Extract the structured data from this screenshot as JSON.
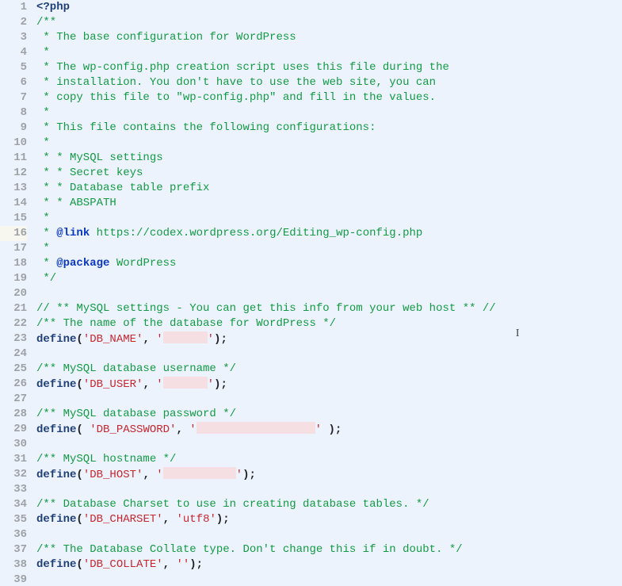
{
  "editor": {
    "current_line": 16,
    "caret_at_line": 22,
    "lines": [
      {
        "n": 1,
        "tokens": [
          {
            "cls": "tk-tag",
            "t": "<?php"
          }
        ]
      },
      {
        "n": 2,
        "tokens": [
          {
            "cls": "tk-comment",
            "t": "/**"
          }
        ]
      },
      {
        "n": 3,
        "tokens": [
          {
            "cls": "tk-comment",
            "t": " * The base configuration for WordPress"
          }
        ]
      },
      {
        "n": 4,
        "tokens": [
          {
            "cls": "tk-comment",
            "t": " *"
          }
        ]
      },
      {
        "n": 5,
        "tokens": [
          {
            "cls": "tk-comment",
            "t": " * The wp-config.php creation script uses this file during the"
          }
        ]
      },
      {
        "n": 6,
        "tokens": [
          {
            "cls": "tk-comment",
            "t": " * installation. You don't have to use the web site, you can"
          }
        ]
      },
      {
        "n": 7,
        "tokens": [
          {
            "cls": "tk-comment",
            "t": " * copy this file to \"wp-config.php\" and fill in the values."
          }
        ]
      },
      {
        "n": 8,
        "tokens": [
          {
            "cls": "tk-comment",
            "t": " *"
          }
        ]
      },
      {
        "n": 9,
        "tokens": [
          {
            "cls": "tk-comment",
            "t": " * This file contains the following configurations:"
          }
        ]
      },
      {
        "n": 10,
        "tokens": [
          {
            "cls": "tk-comment",
            "t": " *"
          }
        ]
      },
      {
        "n": 11,
        "tokens": [
          {
            "cls": "tk-comment",
            "t": " * * MySQL settings"
          }
        ]
      },
      {
        "n": 12,
        "tokens": [
          {
            "cls": "tk-comment",
            "t": " * * Secret keys"
          }
        ]
      },
      {
        "n": 13,
        "tokens": [
          {
            "cls": "tk-comment",
            "t": " * * Database table prefix"
          }
        ]
      },
      {
        "n": 14,
        "tokens": [
          {
            "cls": "tk-comment",
            "t": " * * ABSPATH"
          }
        ]
      },
      {
        "n": 15,
        "tokens": [
          {
            "cls": "tk-comment",
            "t": " *"
          }
        ]
      },
      {
        "n": 16,
        "tokens": [
          {
            "cls": "tk-comment",
            "t": " * "
          },
          {
            "cls": "tk-doctag",
            "t": "@link"
          },
          {
            "cls": "tk-comment",
            "t": " https://codex.wordpress.org/Editing_wp-config.php"
          }
        ]
      },
      {
        "n": 17,
        "tokens": [
          {
            "cls": "tk-comment",
            "t": " *"
          }
        ]
      },
      {
        "n": 18,
        "tokens": [
          {
            "cls": "tk-comment",
            "t": " * "
          },
          {
            "cls": "tk-doctag",
            "t": "@package"
          },
          {
            "cls": "tk-comment",
            "t": " WordPress"
          }
        ]
      },
      {
        "n": 19,
        "tokens": [
          {
            "cls": "tk-comment",
            "t": " */"
          }
        ]
      },
      {
        "n": 20,
        "tokens": [
          {
            "cls": "",
            "t": ""
          }
        ]
      },
      {
        "n": 21,
        "tokens": [
          {
            "cls": "tk-comment",
            "t": "// ** MySQL settings - You can get this info from your web host ** //"
          }
        ]
      },
      {
        "n": 22,
        "tokens": [
          {
            "cls": "tk-comment",
            "t": "/** The name of the database for WordPress */"
          }
        ],
        "caret": true
      },
      {
        "n": 23,
        "tokens": [
          {
            "cls": "tk-tag",
            "t": "define"
          },
          {
            "cls": "tk-punct",
            "t": "("
          },
          {
            "cls": "tk-string",
            "t": "'DB_NAME'"
          },
          {
            "cls": "tk-punct",
            "t": ", "
          },
          {
            "cls": "tk-string",
            "t": "'"
          },
          {
            "cls": "redact w1",
            "t": ""
          },
          {
            "cls": "tk-string",
            "t": "'"
          },
          {
            "cls": "tk-punct",
            "t": ");"
          }
        ]
      },
      {
        "n": 24,
        "tokens": [
          {
            "cls": "",
            "t": ""
          }
        ]
      },
      {
        "n": 25,
        "tokens": [
          {
            "cls": "tk-comment",
            "t": "/** MySQL database username */"
          }
        ]
      },
      {
        "n": 26,
        "tokens": [
          {
            "cls": "tk-tag",
            "t": "define"
          },
          {
            "cls": "tk-punct",
            "t": "("
          },
          {
            "cls": "tk-string",
            "t": "'DB_USER'"
          },
          {
            "cls": "tk-punct",
            "t": ", "
          },
          {
            "cls": "tk-string",
            "t": "'"
          },
          {
            "cls": "redact w2",
            "t": ""
          },
          {
            "cls": "tk-string",
            "t": "'"
          },
          {
            "cls": "tk-punct",
            "t": ");"
          }
        ]
      },
      {
        "n": 27,
        "tokens": [
          {
            "cls": "",
            "t": ""
          }
        ]
      },
      {
        "n": 28,
        "tokens": [
          {
            "cls": "tk-comment",
            "t": "/** MySQL database password */"
          }
        ]
      },
      {
        "n": 29,
        "tokens": [
          {
            "cls": "tk-tag",
            "t": "define"
          },
          {
            "cls": "tk-punct",
            "t": "( "
          },
          {
            "cls": "tk-string",
            "t": "'DB_PASSWORD'"
          },
          {
            "cls": "tk-punct",
            "t": ", "
          },
          {
            "cls": "tk-string",
            "t": "'"
          },
          {
            "cls": "redact w3",
            "t": ""
          },
          {
            "cls": "tk-string",
            "t": "'"
          },
          {
            "cls": "tk-punct",
            "t": " );"
          }
        ]
      },
      {
        "n": 30,
        "tokens": [
          {
            "cls": "",
            "t": ""
          }
        ]
      },
      {
        "n": 31,
        "tokens": [
          {
            "cls": "tk-comment",
            "t": "/** MySQL hostname */"
          }
        ]
      },
      {
        "n": 32,
        "tokens": [
          {
            "cls": "tk-tag",
            "t": "define"
          },
          {
            "cls": "tk-punct",
            "t": "("
          },
          {
            "cls": "tk-string",
            "t": "'DB_HOST'"
          },
          {
            "cls": "tk-punct",
            "t": ", "
          },
          {
            "cls": "tk-string",
            "t": "'"
          },
          {
            "cls": "redact w4",
            "t": ""
          },
          {
            "cls": "tk-string",
            "t": "'"
          },
          {
            "cls": "tk-punct",
            "t": ");"
          }
        ]
      },
      {
        "n": 33,
        "tokens": [
          {
            "cls": "",
            "t": ""
          }
        ]
      },
      {
        "n": 34,
        "tokens": [
          {
            "cls": "tk-comment",
            "t": "/** Database Charset to use in creating database tables. */"
          }
        ]
      },
      {
        "n": 35,
        "tokens": [
          {
            "cls": "tk-tag",
            "t": "define"
          },
          {
            "cls": "tk-punct",
            "t": "("
          },
          {
            "cls": "tk-string",
            "t": "'DB_CHARSET'"
          },
          {
            "cls": "tk-punct",
            "t": ", "
          },
          {
            "cls": "tk-string",
            "t": "'utf8'"
          },
          {
            "cls": "tk-punct",
            "t": ");"
          }
        ]
      },
      {
        "n": 36,
        "tokens": [
          {
            "cls": "",
            "t": ""
          }
        ]
      },
      {
        "n": 37,
        "tokens": [
          {
            "cls": "tk-comment",
            "t": "/** The Database Collate type. Don't change this if in doubt. */"
          }
        ]
      },
      {
        "n": 38,
        "tokens": [
          {
            "cls": "tk-tag",
            "t": "define"
          },
          {
            "cls": "tk-punct",
            "t": "("
          },
          {
            "cls": "tk-string",
            "t": "'DB_COLLATE'"
          },
          {
            "cls": "tk-punct",
            "t": ", "
          },
          {
            "cls": "tk-string",
            "t": "''"
          },
          {
            "cls": "tk-punct",
            "t": ");"
          }
        ]
      },
      {
        "n": 39,
        "tokens": [
          {
            "cls": "",
            "t": ""
          }
        ]
      }
    ]
  }
}
